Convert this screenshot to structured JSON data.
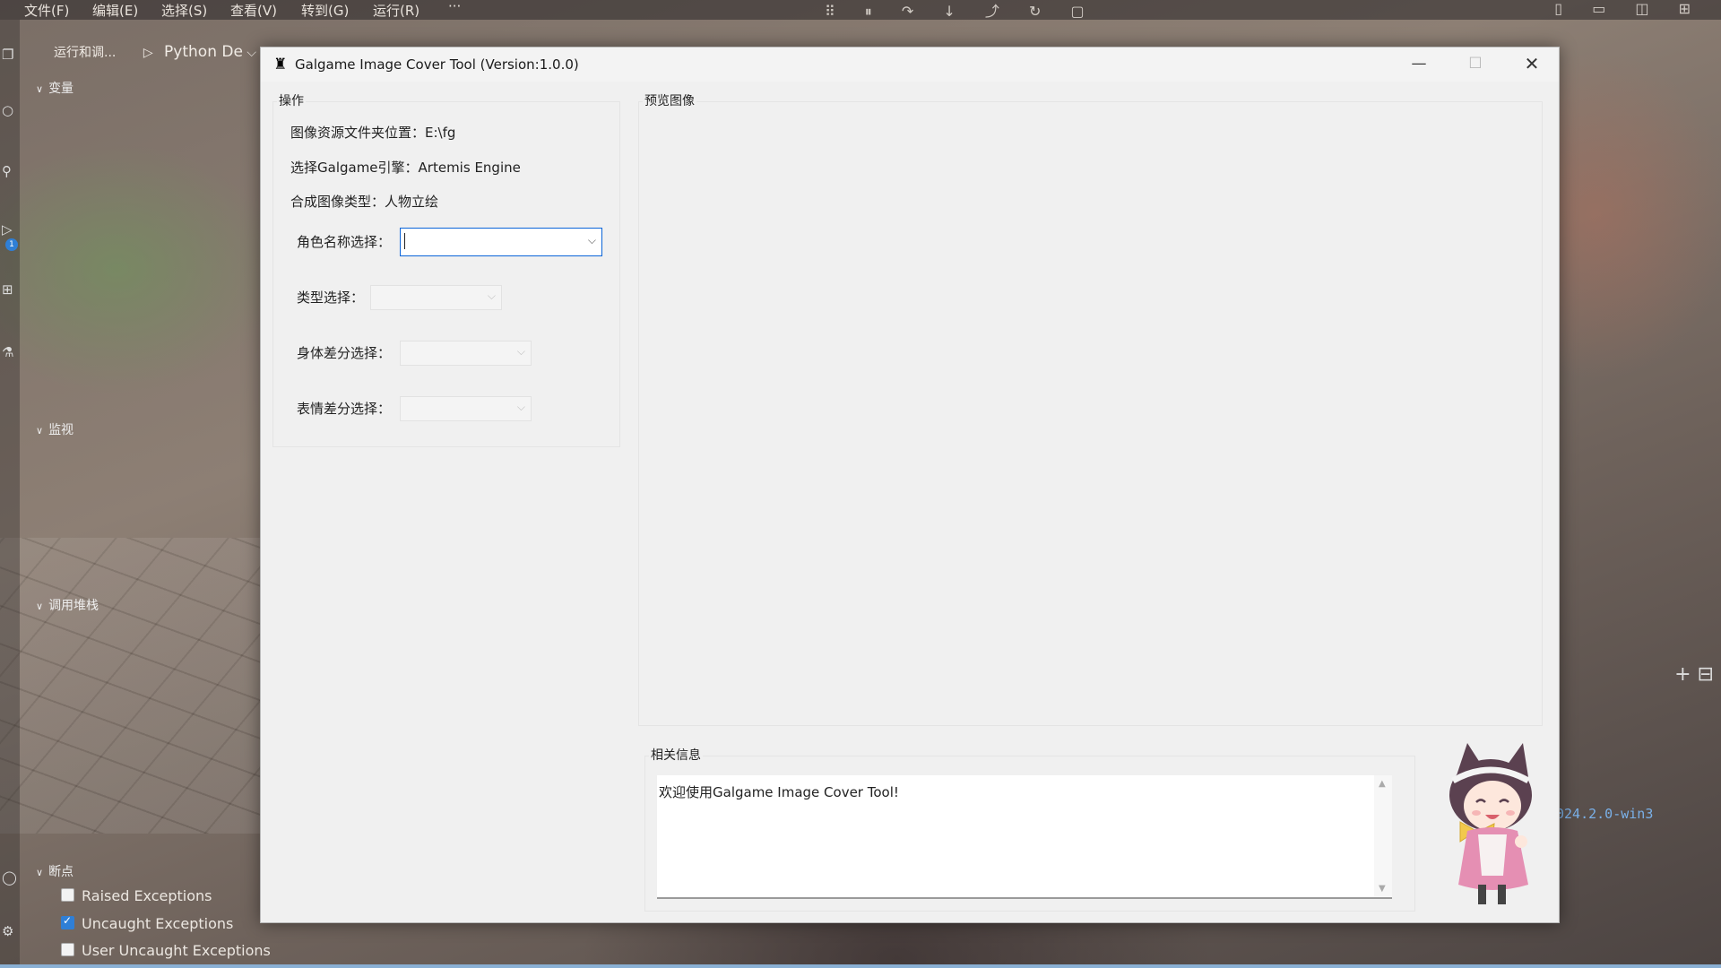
{
  "ide": {
    "menu": [
      "文件(F)",
      "编辑(E)",
      "选择(S)",
      "查看(V)",
      "转到(G)",
      "运行(R)"
    ],
    "menu_more": "···",
    "debug_toolbar_icons": "⠿ ⏸ ↷ ↓ ⤴ ↻ ▢",
    "layout_icons": "▯ ▭ ◫ ⊞",
    "run_panel": {
      "label": "运行和调...",
      "play_icon": "▷",
      "config": "Python De",
      "config_chevron": "⌵"
    },
    "sections": {
      "variables": "变量",
      "watch": "监视",
      "callstack": "调用堆栈",
      "breakpoints": "断点"
    },
    "breakpoints": [
      {
        "label": "Raised Exceptions",
        "checked": false
      },
      {
        "label": "Uncaught Exceptions",
        "checked": true
      },
      {
        "label": "User Uncaught Exceptions",
        "checked": false
      }
    ],
    "activity_badge": "1",
    "terminal_snippet": "024.2.0-win3",
    "right_icons": "+ ⊟"
  },
  "window": {
    "icon": "♜",
    "title": "Galgame Image Cover Tool (Version:1.0.0)",
    "minimize": "—",
    "maximize": "☐",
    "close": "✕"
  },
  "operation": {
    "group_label": "操作",
    "folder_line": "图像资源文件夹位置：E:\\fg",
    "engine_line": "选择Galgame引擎：Artemis Engine",
    "type_line": "合成图像类型：人物立绘",
    "fields": {
      "character_label": "角色名称选择：",
      "character_value": "",
      "type_label": "类型选择：",
      "body_label": "身体差分选择：",
      "expression_label": "表情差分选择："
    }
  },
  "preview": {
    "group_label": "预览图像"
  },
  "info": {
    "group_label": "相关信息",
    "message": "欢迎使用Galgame Image Cover Tool!"
  },
  "colors": {
    "accent": "#0a64d8",
    "window_bg": "#f0f0f0",
    "checkbox_on": "#2f7fd6"
  }
}
